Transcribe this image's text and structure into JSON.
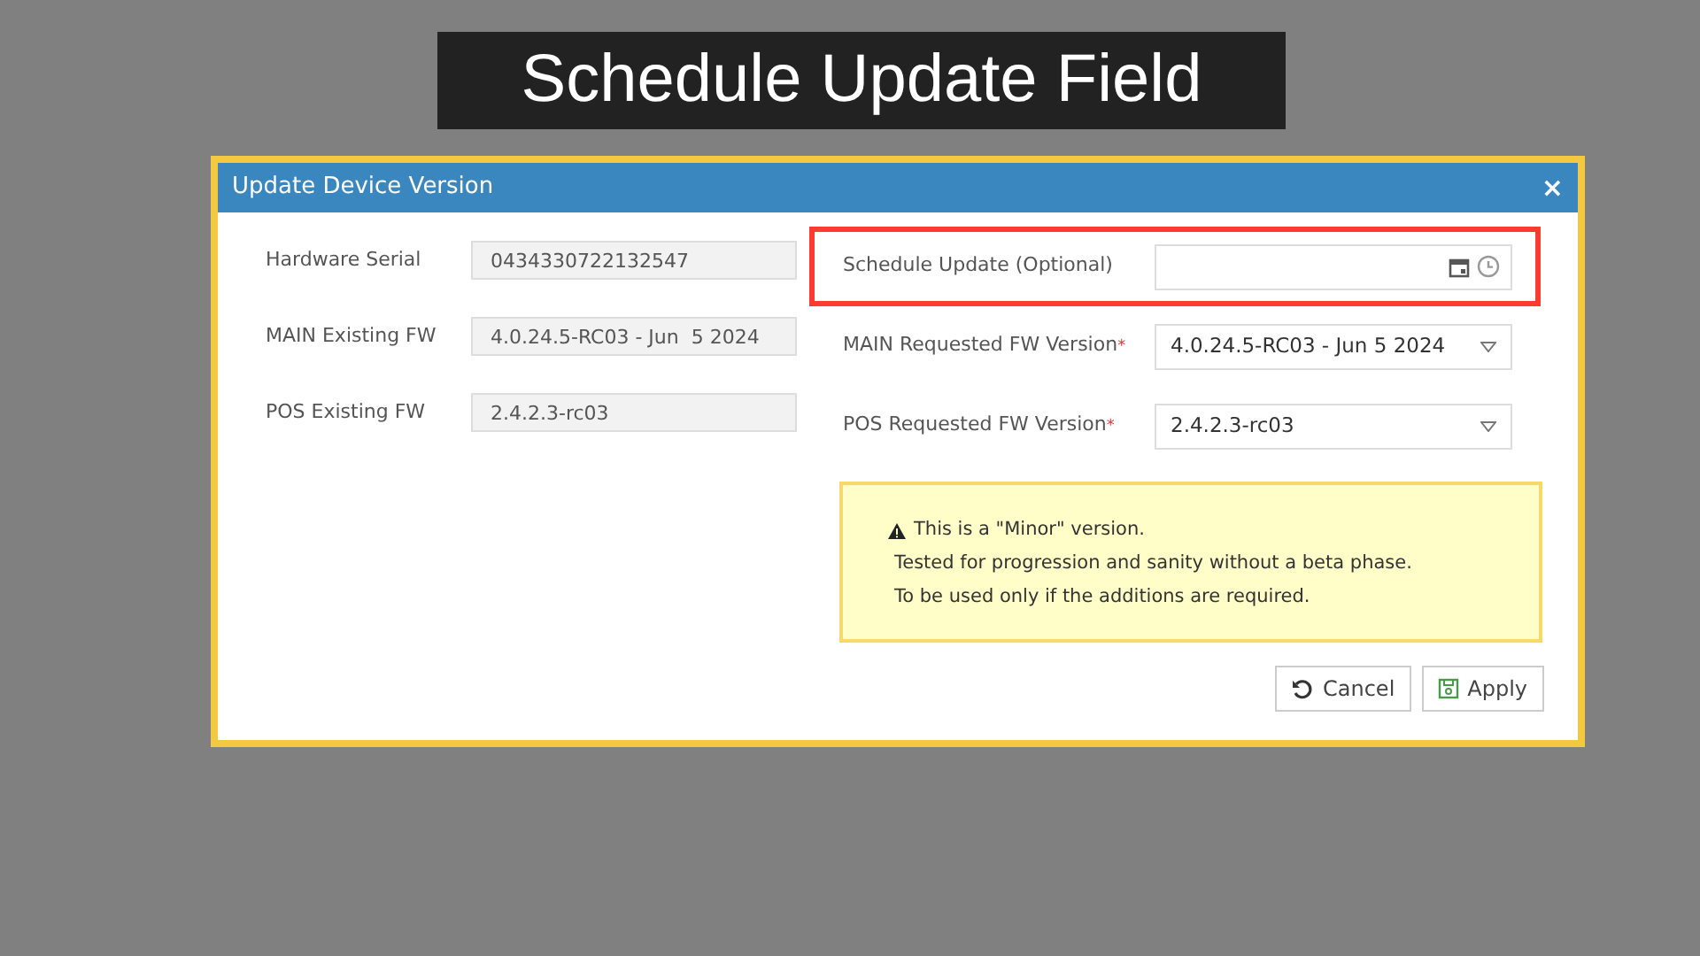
{
  "slide_title": "Schedule Update Field",
  "window": {
    "title": "Update Device Version",
    "close": "×"
  },
  "existing_fields": [
    {
      "label": "Hardware Serial",
      "value": "0434330722132547"
    },
    {
      "label": "MAIN Existing FW",
      "value": "4.0.24.5-RC03 - Jun  5 2024"
    },
    {
      "label": "POS Existing FW",
      "value": "2.4.2.3-rc03"
    }
  ],
  "requested_fields": [
    {
      "kind": "datetime",
      "label": "Schedule Update (Optional)",
      "highlighted": true
    },
    {
      "kind": "select",
      "label": "MAIN Requested FW Version",
      "required_mark": "*",
      "highlighted": false,
      "value": "4.0.24.5-RC03 - Jun 5 2024"
    },
    {
      "kind": "select",
      "label": "POS Requested FW Version",
      "required_mark": "*",
      "highlighted": false,
      "value": "2.4.2.3-rc03"
    }
  ],
  "notice": {
    "lines": [
      "This is a \"Minor\" version.",
      "Tested for progression and sanity without a beta phase.",
      "To be used only if the additions are required."
    ]
  },
  "buttons": [
    {
      "kind": "cancel",
      "label": "Cancel"
    },
    {
      "kind": "apply",
      "label": "Apply"
    }
  ]
}
